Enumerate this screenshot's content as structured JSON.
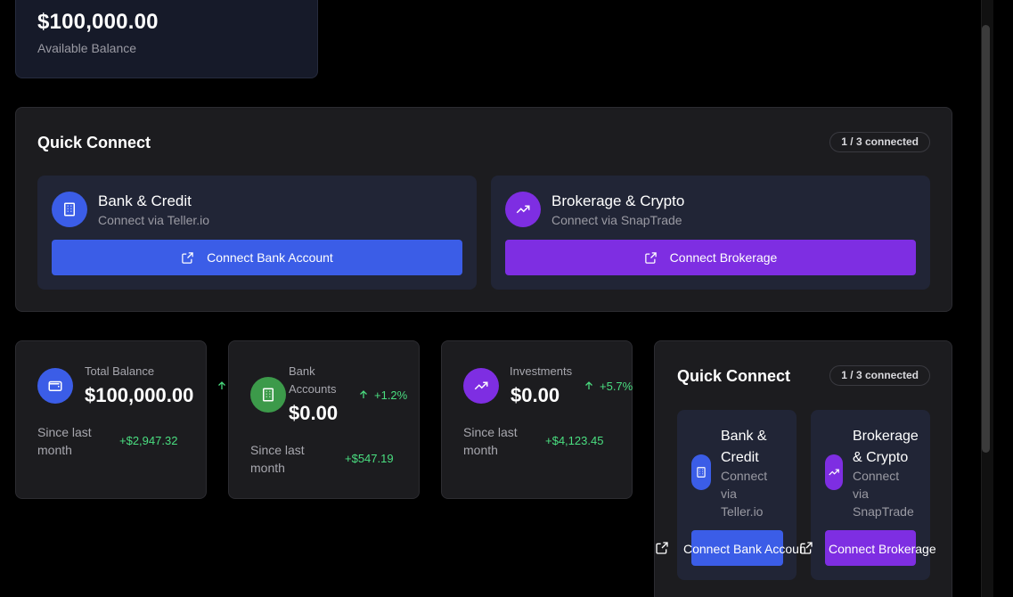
{
  "balance": {
    "amount": "$100,000.00",
    "label": "Available Balance"
  },
  "quick_connect_1": {
    "title": "Quick Connect",
    "badge": "1 / 3 connected",
    "bank": {
      "title": "Bank & Credit",
      "subtitle": "Connect via Teller.io",
      "button": "Connect Bank Account",
      "icon": "building-icon"
    },
    "brokerage": {
      "title": "Brokerage & Crypto",
      "subtitle": "Connect via SnapTrade",
      "button": "Connect Brokerage",
      "icon": "trending-up-icon"
    }
  },
  "stats": [
    {
      "label": "Total Balance",
      "value": "$100,000.00",
      "since": "Since last month",
      "delta": "+$2,947.32",
      "icon": "wallet-icon"
    },
    {
      "label": "Bank Accounts",
      "value": "$0.00",
      "change": "+1.2%",
      "since": "Since last month",
      "delta": "+$547.19",
      "icon": "building-icon"
    },
    {
      "label": "Investments",
      "value": "$0.00",
      "change": "+5.7%",
      "since": "Since last month",
      "delta": "+$4,123.45",
      "icon": "trending-up-icon"
    }
  ],
  "quick_connect_2": {
    "title": "Quick Connect",
    "badge": "1 / 3 connected",
    "bank": {
      "title_line1": "Bank &",
      "title_line2": "Credit",
      "sub_line1": "Connect",
      "sub_line2": "via",
      "sub_line3": "Teller.io",
      "button": "Connect Bank Account"
    },
    "brokerage": {
      "title_line1": "Brokerage",
      "title_line2": "& Crypto",
      "sub_line1": "Connect",
      "sub_line2": "via",
      "sub_line3": "SnapTrade",
      "button": "Connect Brokerage"
    }
  },
  "colors": {
    "blue": "#3b5de7",
    "purple": "#7e2ee2",
    "green": "#3c9a4a",
    "positive": "#4ade80"
  }
}
